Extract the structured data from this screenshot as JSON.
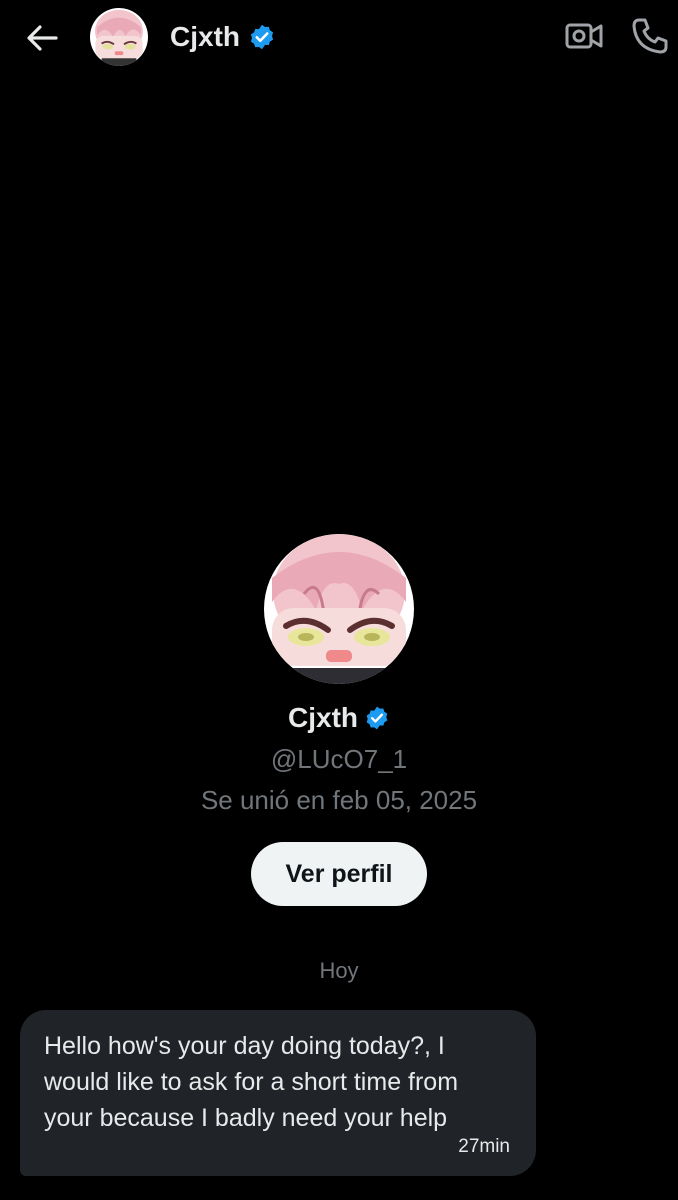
{
  "header": {
    "name": "Cjxth",
    "back_icon": "arrow-left-icon",
    "video_icon": "video-call-icon",
    "call_icon": "phone-icon",
    "verified_icon": "verified-badge-icon"
  },
  "profile": {
    "name": "Cjxth",
    "handle": "@LUcO7_1",
    "joined": "Se unió en feb 05, 2025",
    "view_profile_label": "Ver perfil"
  },
  "conversation": {
    "date_separator": "Hoy",
    "messages": [
      {
        "text": "Hello how's your day doing today?, I would like to ask for a short time from your because I badly need your help",
        "time": "27min"
      }
    ]
  },
  "colors": {
    "background": "#000000",
    "text_primary": "#e7e9ea",
    "text_secondary": "#71767b",
    "verified": "#1d9bf0",
    "bubble": "#202327",
    "button_bg": "#eff3f4"
  }
}
